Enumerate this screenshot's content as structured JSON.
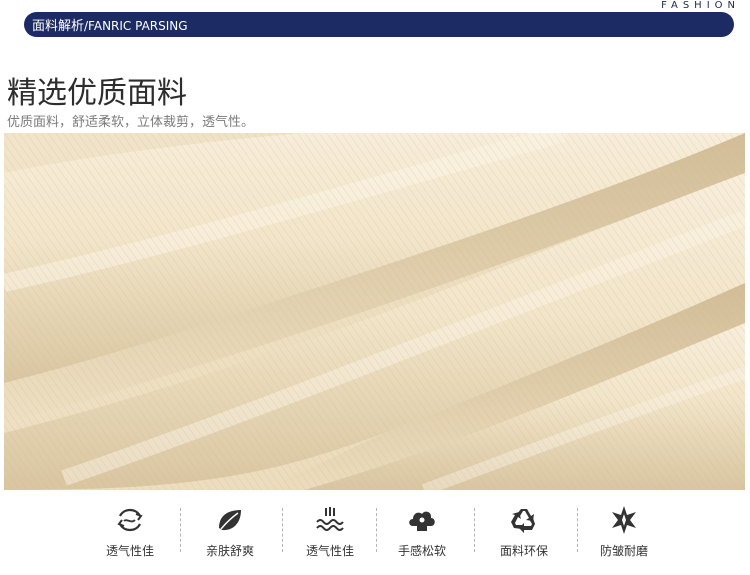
{
  "brand_tag": "FASHION",
  "header": {
    "title_cn": "面料解析",
    "title_en": "/FANRIC PARSING"
  },
  "heading": "精选优质面料",
  "subheading": "优质面料，舒适柔软，立体裁剪，透气性。",
  "colors": {
    "header_bar": "#1c2b63",
    "fabric": "#efe2c8"
  },
  "features": [
    {
      "label": "透气性佳",
      "icon": "airflow-icon"
    },
    {
      "label": "亲肤舒爽",
      "icon": "leaf-icon"
    },
    {
      "label": "透气性佳",
      "icon": "steam-wave-icon"
    },
    {
      "label": "手感松软",
      "icon": "cloud-icon"
    },
    {
      "label": "面料环保",
      "icon": "recycle-icon"
    },
    {
      "label": "防皱耐磨",
      "icon": "star-shield-icon"
    }
  ]
}
